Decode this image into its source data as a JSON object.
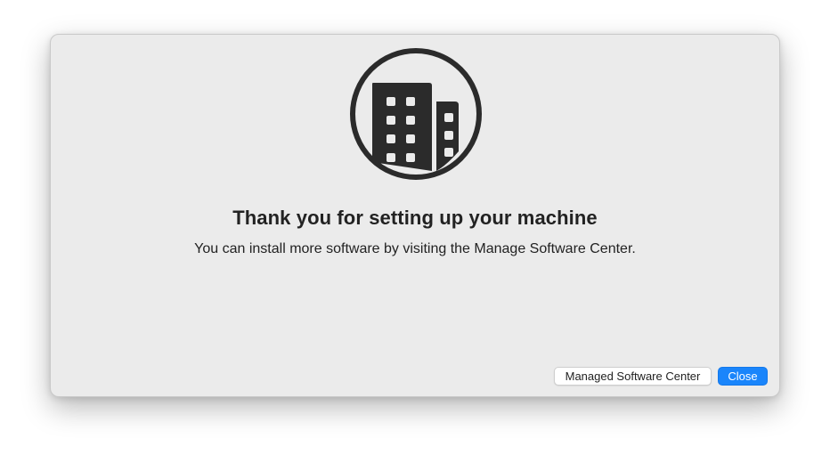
{
  "dialog": {
    "icon": "office-building-icon",
    "title": "Thank you for setting up your machine",
    "message": "You can install more software by visiting the Manage Software Center."
  },
  "buttons": {
    "secondary_label": "Managed Software Center",
    "primary_label": "Close"
  },
  "colors": {
    "window_background": "#ebebeb",
    "icon_color": "#2b2b2b",
    "primary_button": "#1a85fb",
    "text": "#222222"
  }
}
